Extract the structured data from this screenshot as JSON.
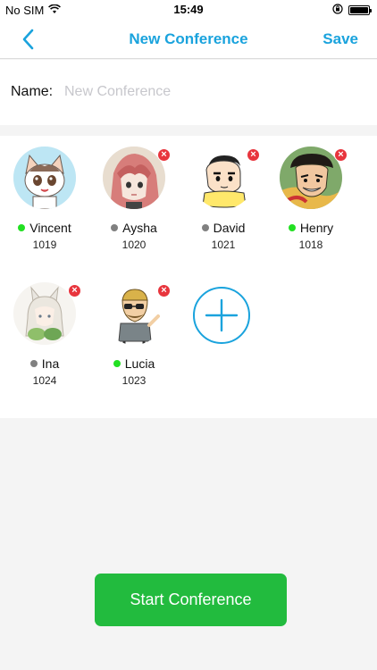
{
  "status_bar": {
    "carrier": "No SIM",
    "time": "15:49",
    "icons": [
      "wifi-icon",
      "orientation-lock-icon",
      "battery-icon"
    ]
  },
  "nav": {
    "back_icon": "chevron-left-icon",
    "title": "New Conference",
    "save_label": "Save"
  },
  "form": {
    "name_label": "Name:",
    "name_value": "",
    "name_placeholder": "New Conference"
  },
  "members": [
    {
      "name": "Vincent",
      "ext": "1019",
      "status": "online",
      "removable": false
    },
    {
      "name": "Aysha",
      "ext": "1020",
      "status": "offline",
      "removable": true
    },
    {
      "name": "David",
      "ext": "1021",
      "status": "offline",
      "removable": true
    },
    {
      "name": "Henry",
      "ext": "1018",
      "status": "online",
      "removable": true
    },
    {
      "name": "Ina",
      "ext": "1024",
      "status": "offline",
      "removable": true
    },
    {
      "name": "Lucia",
      "ext": "1023",
      "status": "online",
      "removable": true
    }
  ],
  "remove_glyph": "×",
  "add_member_icon": "plus-circle-icon",
  "start_button_label": "Start Conference",
  "colors": {
    "accent": "#1aa3dd",
    "online": "#22e022",
    "offline": "#808080",
    "remove": "#e8353d",
    "start": "#22bb3e"
  }
}
